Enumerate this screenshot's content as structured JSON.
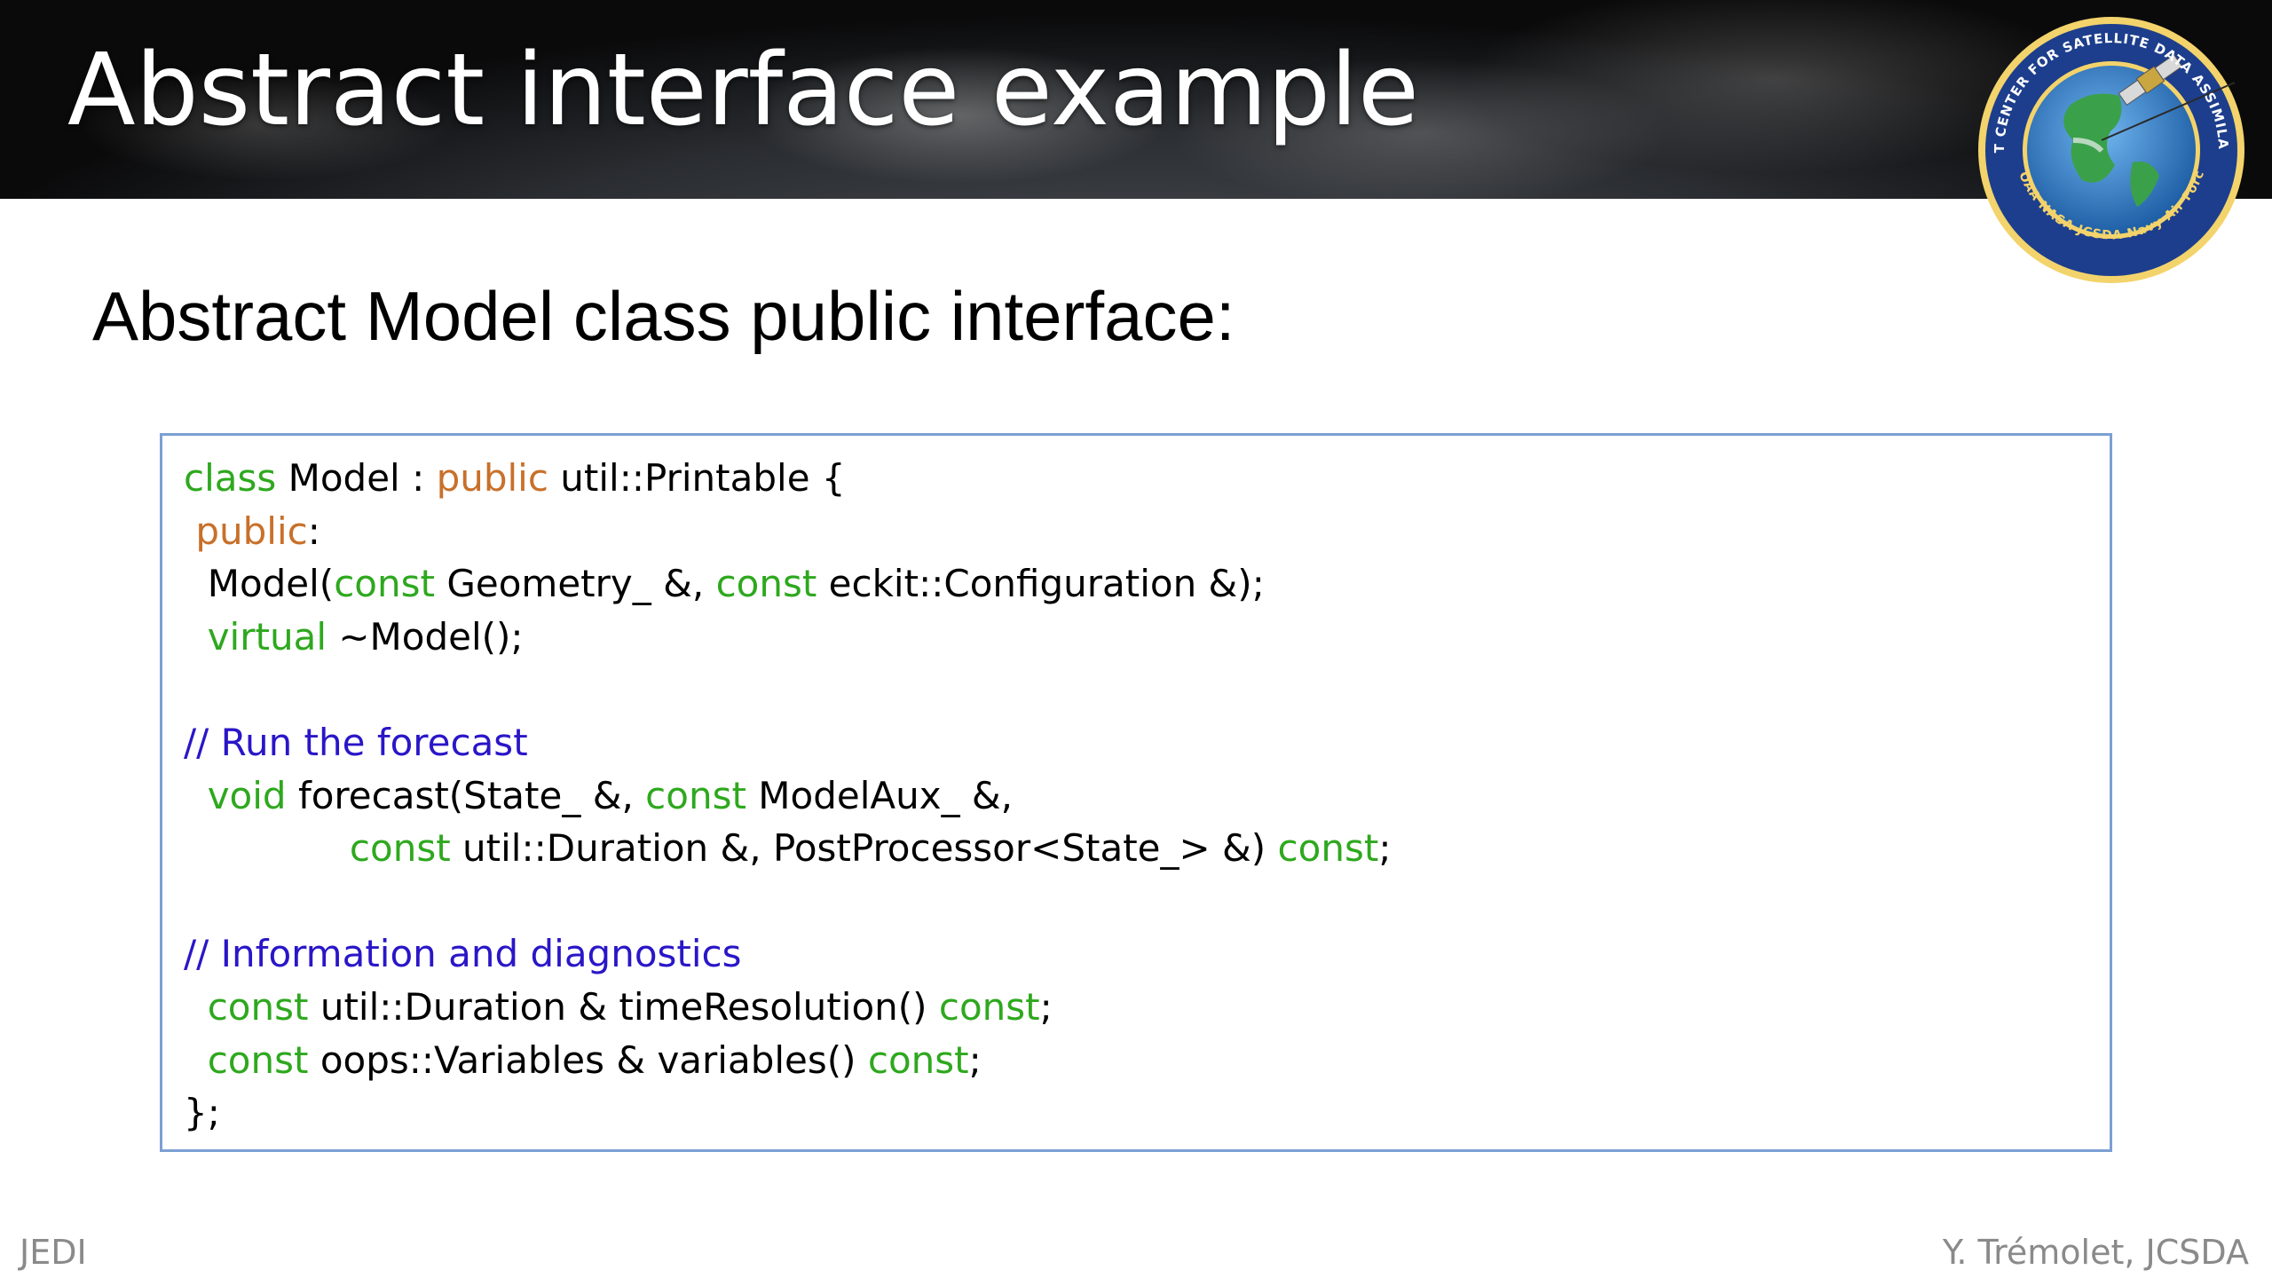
{
  "slide": {
    "title": "Abstract interface example",
    "subtitle": "Abstract Model class public interface:"
  },
  "logo": {
    "ring_text_top": "JOINT CENTER FOR SATELLITE DATA ASSIMILATION",
    "ring_text_bottom": "NOAA NASA JCSDA Navy Air Force",
    "icon": "jcsda-globe-satellite-logo"
  },
  "colors": {
    "keyword": "#2ea81e",
    "access": "#c8702a",
    "comment": "#2a16c8",
    "code_border": "#7b9fd3",
    "footer": "#8a8a8a"
  },
  "code": {
    "line1": {
      "kw_class": "class",
      "t1": " Model : ",
      "kw_public": "public",
      "t2": " util::Printable {"
    },
    "line2": {
      "lead": " ",
      "kw_public": "public",
      "t1": ":"
    },
    "line3": {
      "t1": "  Model(",
      "kw_const1": "const",
      "t2": " Geometry_ &, ",
      "kw_const2": "const",
      "t3": " eckit::Configuration &);"
    },
    "line4": {
      "lead": "  ",
      "kw_virtual": "virtual",
      "t1": " ~Model();"
    },
    "line6": {
      "comment": "// Run the forecast"
    },
    "line7": {
      "lead": "  ",
      "kw_void": "void",
      "t1": " forecast(State_ &, ",
      "kw_const": "const",
      "t2": " ModelAux_ &,"
    },
    "line8": {
      "lead": "              ",
      "kw_const1": "const",
      "t1": " util::Duration &, PostProcessor<State_> &) ",
      "kw_const2": "const",
      "t2": ";"
    },
    "line10": {
      "comment": "// Information and diagnostics"
    },
    "line11": {
      "lead": "  ",
      "kw_const1": "const",
      "t1": " util::Duration & timeResolution() ",
      "kw_const2": "const",
      "t2": ";"
    },
    "line12": {
      "lead": "  ",
      "kw_const1": "const",
      "t1": " oops::Variables & variables() ",
      "kw_const2": "const",
      "t2": ";"
    },
    "line13": {
      "t1": "};"
    }
  },
  "footer": {
    "left": "JEDI",
    "right": "Y. Trémolet, JCSDA"
  }
}
